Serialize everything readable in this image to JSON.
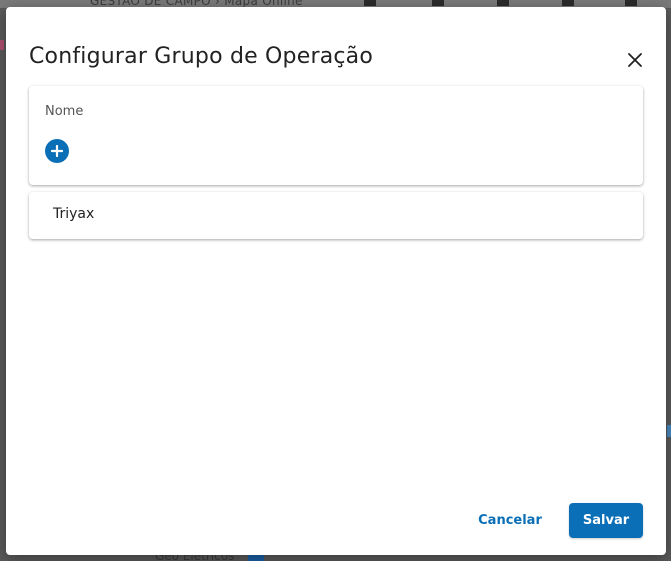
{
  "background": {
    "breadcrumb": "GESTÃO DE CAMPO  ›  Mapa Online",
    "footer_text": "Geo Elétricos"
  },
  "dialog": {
    "title": "Configurar Grupo de Operação",
    "close_icon": "close-icon",
    "header": {
      "label": "Nome",
      "add_icon": "plus-circle-icon"
    },
    "rows": [
      {
        "name": "Triyax"
      }
    ],
    "actions": {
      "cancel_label": "Cancelar",
      "save_label": "Salvar"
    }
  },
  "colors": {
    "accent": "#0b6fb8",
    "backdrop": "#5a5a5a",
    "surface": "#ffffff",
    "text_primary": "#222222",
    "text_secondary": "#555555"
  }
}
